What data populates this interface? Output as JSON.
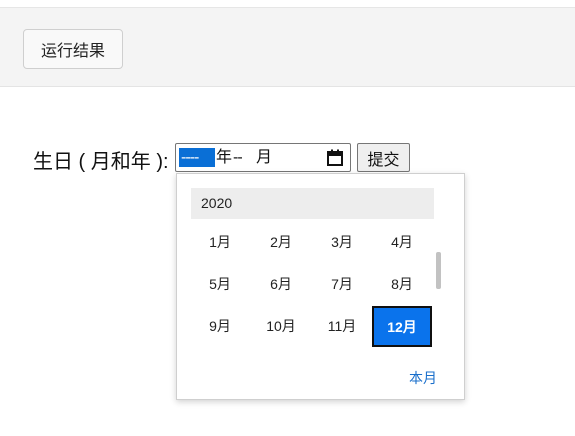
{
  "toolbar": {
    "run_label": "运行结果"
  },
  "form": {
    "label": "生日 ( 月和年 ):",
    "year_placeholder": "----",
    "year_unit": "年",
    "month_placeholder": "--",
    "month_unit": "月",
    "submit_label": "提交"
  },
  "picker": {
    "year": "2020",
    "months": [
      "1月",
      "2月",
      "3月",
      "4月",
      "5月",
      "6月",
      "7月",
      "8月",
      "9月",
      "10月",
      "11月",
      "12月"
    ],
    "selected_month": "12月",
    "this_month_label": "本月"
  },
  "colors": {
    "selected": "#0a73ec",
    "link": "#1a6fcb",
    "segment_highlight": "#0a6fd6"
  }
}
